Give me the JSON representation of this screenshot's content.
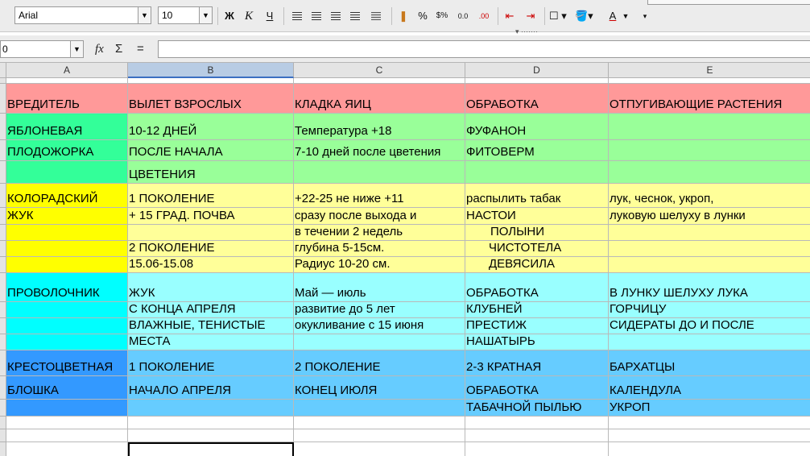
{
  "toolbar": {
    "font_name": "Arial",
    "font_size": "10",
    "bold_label": "Ж",
    "italic_label": "К",
    "underline_label": "Ч",
    "percent_label": "%",
    "currency_label": "$%",
    "decimal_add_label": "0.0",
    "decimal_del_label": ".00",
    "font_color_label": "A"
  },
  "formula_bar": {
    "name_box": "0",
    "fx_label": "fx",
    "sum_label": "Σ",
    "equals_label": "=",
    "formula": ""
  },
  "columns": [
    "A",
    "B",
    "C",
    "D",
    "E"
  ],
  "active_column": "B",
  "colors": {
    "header_row": "#ff9999",
    "green": "#99ff99",
    "green_a": "#33ff99",
    "yellow": "#ffff99",
    "yellow_a": "#ffff00",
    "cyan": "#99ffff",
    "cyan_a": "#00ffff",
    "blue": "#66ccff",
    "blue_a": "#3399ff"
  },
  "rows": [
    [
      "ВРЕДИТЕЛЬ",
      "ВЫЛЕТ ВЗРОСЛЫХ",
      "КЛАДКА ЯИЦ",
      "ОБРАБОТКА",
      "ОТПУГИВАЮЩИЕ РАСТЕНИЯ"
    ],
    [
      "ЯБЛОНЕВАЯ",
      "10-12 ДНЕЙ",
      "Температура +18",
      "ФУФАНОН",
      ""
    ],
    [
      "ПЛОДОЖОРКА",
      "ПОСЛЕ НАЧАЛА",
      "7-10 дней после цветения",
      "ФИТОВЕРМ",
      ""
    ],
    [
      "",
      "ЦВЕТЕНИЯ",
      "",
      "",
      ""
    ],
    [
      "КОЛОРАДСКИЙ",
      "1 ПОКОЛЕНИЕ",
      "+22-25 не ниже +11",
      "распылить табак",
      "лук, чеснок, укроп,"
    ],
    [
      "ЖУК",
      "+ 15 ГРАД. ПОЧВА",
      "сразу после выхода и",
      "НАСТОИ",
      "луковую шелуху в лунки"
    ],
    [
      "",
      "",
      "в течении 2 недель",
      "ПОЛЫНИ",
      ""
    ],
    [
      "",
      "2 ПОКОЛЕНИЕ",
      "глубина 5-15см.",
      "ЧИСТОТЕЛА",
      ""
    ],
    [
      "",
      " 15.06-15.08",
      "Радиус 10-20 см.",
      "ДЕВЯСИЛА",
      ""
    ],
    [
      "ПРОВОЛОЧНИК",
      "ЖУК",
      "Май — июль",
      "ОБРАБОТКА",
      "В ЛУНКУ ШЕЛУХУ ЛУКА"
    ],
    [
      "",
      "С КОНЦА АПРЕЛЯ",
      "развитие до 5 лет",
      "КЛУБНЕЙ",
      "ГОРЧИЦУ"
    ],
    [
      "",
      "ВЛАЖНЫЕ, ТЕНИСТЫЕ",
      "окукливание с 15 июня",
      "ПРЕСТИЖ",
      "СИДЕРАТЫ ДО И ПОСЛЕ"
    ],
    [
      "",
      "МЕСТА",
      "",
      "НАШАТЫРЬ",
      ""
    ],
    [
      "КРЕСТОЦВЕТНАЯ",
      "1 ПОКОЛЕНИЕ",
      "2 ПОКОЛЕНИЕ",
      "2-3 КРАТНАЯ",
      "БАРХАТЦЫ"
    ],
    [
      "БЛОШКА",
      "НАЧАЛО АПРЕЛЯ",
      "КОНЕЦ ИЮЛЯ",
      "ОБРАБОТКА",
      "КАЛЕНДУЛА"
    ],
    [
      "",
      "",
      "",
      "ТАБАЧНОЙ ПЫЛЬЮ",
      "УКРОП"
    ]
  ]
}
